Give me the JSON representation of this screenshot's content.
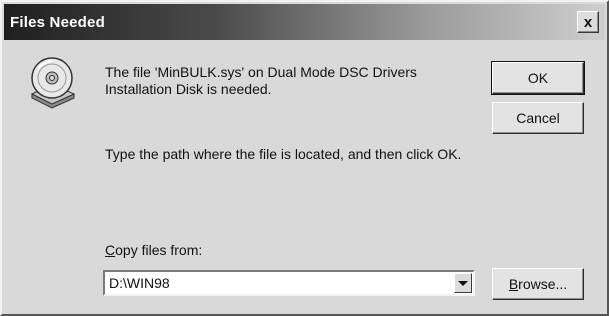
{
  "window": {
    "title": "Files Needed",
    "close_label": "x"
  },
  "message": {
    "line1": "The file 'MinBULK.sys' on Dual Mode DSC Drivers Installation Disk is needed.",
    "line2": "Type the path where the file is located, and then click OK."
  },
  "copy_from": {
    "label_underlined": "C",
    "label_rest": "opy files from:",
    "value": "D:\\WIN98"
  },
  "buttons": {
    "ok": "OK",
    "cancel": "Cancel",
    "browse_underlined": "B",
    "browse_rest": "rowse..."
  },
  "icons": {
    "disk": "cd-disk-icon",
    "dropdown": "chevron-down-icon"
  }
}
